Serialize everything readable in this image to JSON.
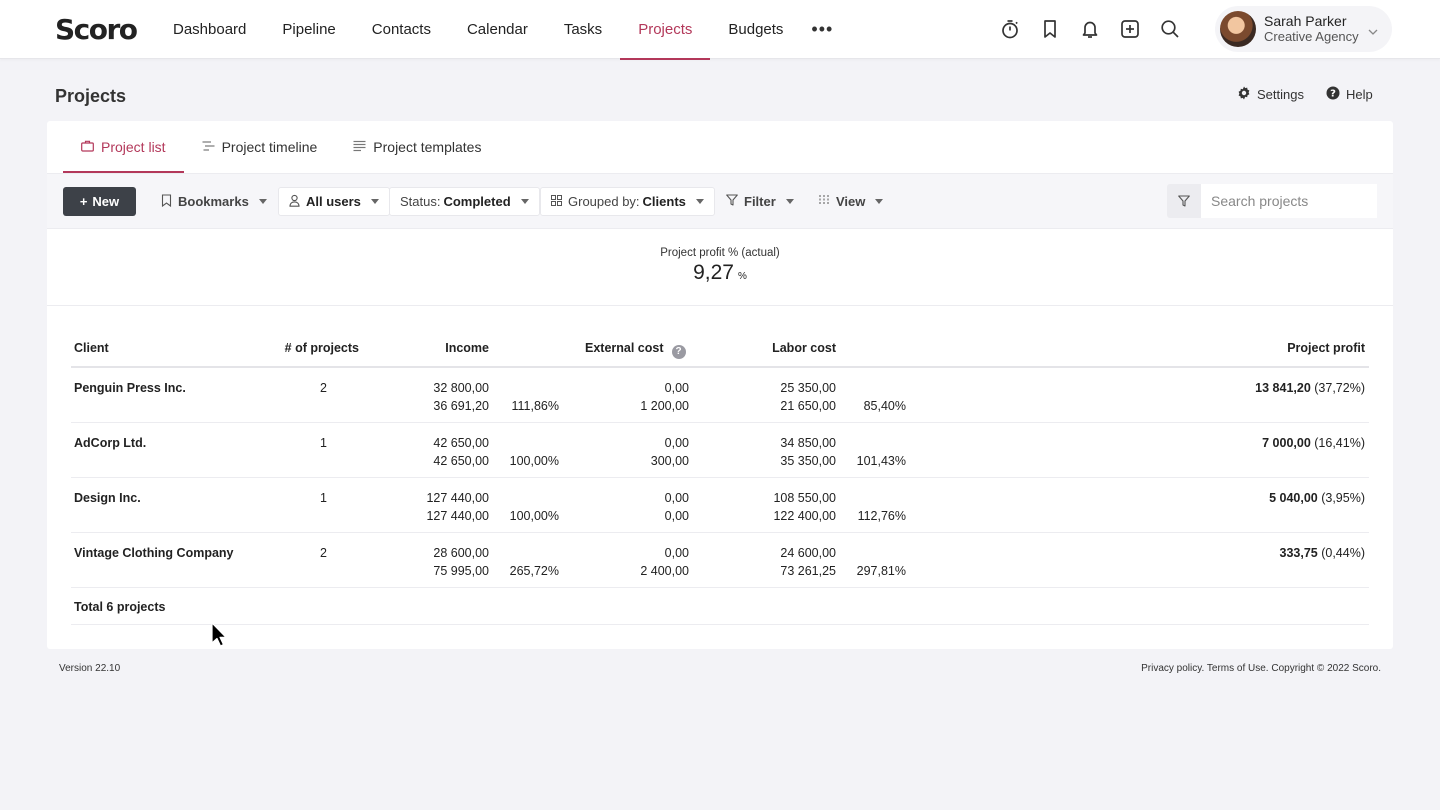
{
  "app": {
    "logo": "Scoro"
  },
  "nav": {
    "items": [
      {
        "label": "Dashboard",
        "active": false
      },
      {
        "label": "Pipeline",
        "active": false
      },
      {
        "label": "Contacts",
        "active": false
      },
      {
        "label": "Calendar",
        "active": false
      },
      {
        "label": "Tasks",
        "active": false
      },
      {
        "label": "Projects",
        "active": true
      },
      {
        "label": "Budgets",
        "active": false
      }
    ],
    "more": "•••",
    "icons": [
      "timer-icon",
      "bookmark-icon",
      "bell-icon",
      "plus-square-icon",
      "search-icon"
    ]
  },
  "user": {
    "name": "Sarah Parker",
    "org": "Creative Agency"
  },
  "page": {
    "title": "Projects",
    "settings": "Settings",
    "help": "Help"
  },
  "tabs": [
    {
      "label": "Project list",
      "active": true
    },
    {
      "label": "Project timeline",
      "active": false
    },
    {
      "label": "Project templates",
      "active": false
    }
  ],
  "toolbar": {
    "new_label": "New",
    "bookmarks": "Bookmarks",
    "users": "All users",
    "status_prefix": "Status:",
    "status_value": "Completed",
    "grouped_prefix": "Grouped by:",
    "grouped_value": "Clients",
    "filter": "Filter",
    "view": "View",
    "search_placeholder": "Search projects"
  },
  "kpi": {
    "label": "Project profit % (actual)",
    "value": "9,27",
    "unit": "%"
  },
  "table": {
    "headers": {
      "client": "Client",
      "projects": "# of projects",
      "income": "Income",
      "external": "External cost",
      "labor": "Labor cost",
      "profit": "Project profit"
    },
    "rows": [
      {
        "client": "Penguin Press Inc.",
        "projects": "2",
        "income1": "32 800,00",
        "income2": "36 691,20",
        "income_pct": "111,86%",
        "ext1": "0,00",
        "ext2": "1 200,00",
        "labor1": "25 350,00",
        "labor2": "21 650,00",
        "labor_pct": "85,40%",
        "profit": "13 841,20",
        "profit_pct": "(37,72%)"
      },
      {
        "client": "AdCorp Ltd.",
        "projects": "1",
        "income1": "42 650,00",
        "income2": "42 650,00",
        "income_pct": "100,00%",
        "ext1": "0,00",
        "ext2": "300,00",
        "labor1": "34 850,00",
        "labor2": "35 350,00",
        "labor_pct": "101,43%",
        "profit": "7 000,00",
        "profit_pct": "(16,41%)"
      },
      {
        "client": "Design Inc.",
        "projects": "1",
        "income1": "127 440,00",
        "income2": "127 440,00",
        "income_pct": "100,00%",
        "ext1": "0,00",
        "ext2": "0,00",
        "labor1": "108 550,00",
        "labor2": "122 400,00",
        "labor_pct": "112,76%",
        "profit": "5 040,00",
        "profit_pct": "(3,95%)"
      },
      {
        "client": "Vintage Clothing Company",
        "projects": "2",
        "income1": "28 600,00",
        "income2": "75 995,00",
        "income_pct": "265,72%",
        "ext1": "0,00",
        "ext2": "2 400,00",
        "labor1": "24 600,00",
        "labor2": "73 261,25",
        "labor_pct": "297,81%",
        "profit": "333,75",
        "profit_pct": "(0,44%)"
      }
    ],
    "total": "Total 6 projects"
  },
  "footer": {
    "version": "Version 22.10",
    "legal": "Privacy policy. Terms of Use. Copyright © 2022 Scoro."
  },
  "colors": {
    "accent": "#b3385a",
    "new_button": "#3d4148",
    "logo_mark": "#e63946"
  }
}
